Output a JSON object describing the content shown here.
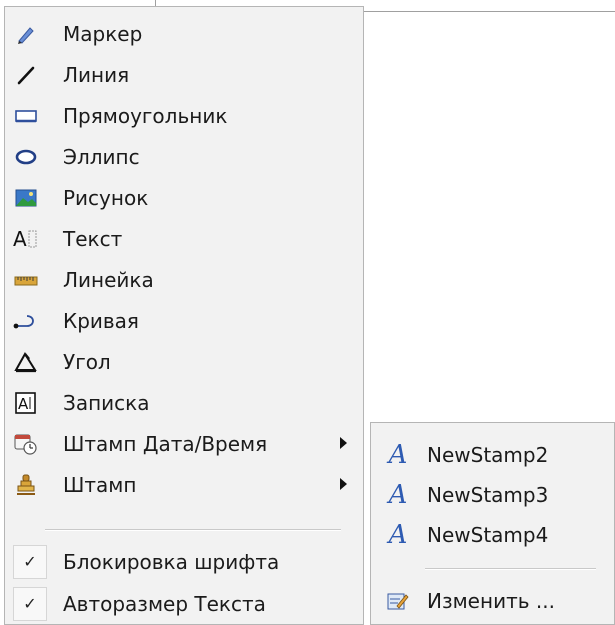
{
  "main_menu": {
    "items": [
      {
        "label": "Маркер",
        "icon": "marker-icon"
      },
      {
        "label": "Линия",
        "icon": "line-icon"
      },
      {
        "label": "Прямоугольник",
        "icon": "rectangle-icon"
      },
      {
        "label": "Эллипс",
        "icon": "ellipse-icon"
      },
      {
        "label": "Рисунок",
        "icon": "picture-icon"
      },
      {
        "label": "Текст",
        "icon": "text-icon"
      },
      {
        "label": "Линейка",
        "icon": "ruler-icon"
      },
      {
        "label": "Кривая",
        "icon": "curve-icon"
      },
      {
        "label": "Угол",
        "icon": "angle-icon"
      },
      {
        "label": "Записка",
        "icon": "note-icon"
      },
      {
        "label": "Штамп Дата/Время",
        "icon": "date-time-stamp-icon",
        "submenu": true
      },
      {
        "label": "Штамп",
        "icon": "stamp-icon",
        "submenu": true
      }
    ],
    "checks": [
      {
        "label": "Блокировка шрифта",
        "checked": true,
        "mark": "✓"
      },
      {
        "label": "Авторазмер Текста",
        "checked": true,
        "mark": "✓"
      }
    ]
  },
  "stamp_submenu": {
    "items": [
      {
        "label": "NewStamp2",
        "icon": "stamp-a-icon",
        "glyph": "A"
      },
      {
        "label": "NewStamp3",
        "icon": "stamp-a-icon",
        "glyph": "A"
      },
      {
        "label": "NewStamp4",
        "icon": "stamp-a-icon",
        "glyph": "A"
      }
    ],
    "edit_label": "Изменить ..."
  }
}
